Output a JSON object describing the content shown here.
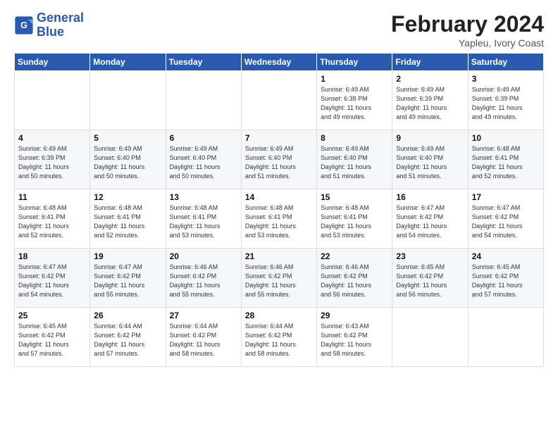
{
  "logo": {
    "line1": "General",
    "line2": "Blue"
  },
  "title": "February 2024",
  "subtitle": "Yapleu, Ivory Coast",
  "days_header": [
    "Sunday",
    "Monday",
    "Tuesday",
    "Wednesday",
    "Thursday",
    "Friday",
    "Saturday"
  ],
  "weeks": [
    [
      {
        "day": "",
        "info": ""
      },
      {
        "day": "",
        "info": ""
      },
      {
        "day": "",
        "info": ""
      },
      {
        "day": "",
        "info": ""
      },
      {
        "day": "1",
        "info": "Sunrise: 6:49 AM\nSunset: 6:38 PM\nDaylight: 11 hours\nand 49 minutes."
      },
      {
        "day": "2",
        "info": "Sunrise: 6:49 AM\nSunset: 6:39 PM\nDaylight: 11 hours\nand 49 minutes."
      },
      {
        "day": "3",
        "info": "Sunrise: 6:49 AM\nSunset: 6:39 PM\nDaylight: 11 hours\nand 49 minutes."
      }
    ],
    [
      {
        "day": "4",
        "info": "Sunrise: 6:49 AM\nSunset: 6:39 PM\nDaylight: 11 hours\nand 50 minutes."
      },
      {
        "day": "5",
        "info": "Sunrise: 6:49 AM\nSunset: 6:40 PM\nDaylight: 11 hours\nand 50 minutes."
      },
      {
        "day": "6",
        "info": "Sunrise: 6:49 AM\nSunset: 6:40 PM\nDaylight: 11 hours\nand 50 minutes."
      },
      {
        "day": "7",
        "info": "Sunrise: 6:49 AM\nSunset: 6:40 PM\nDaylight: 11 hours\nand 51 minutes."
      },
      {
        "day": "8",
        "info": "Sunrise: 6:49 AM\nSunset: 6:40 PM\nDaylight: 11 hours\nand 51 minutes."
      },
      {
        "day": "9",
        "info": "Sunrise: 6:49 AM\nSunset: 6:40 PM\nDaylight: 11 hours\nand 51 minutes."
      },
      {
        "day": "10",
        "info": "Sunrise: 6:48 AM\nSunset: 6:41 PM\nDaylight: 11 hours\nand 52 minutes."
      }
    ],
    [
      {
        "day": "11",
        "info": "Sunrise: 6:48 AM\nSunset: 6:41 PM\nDaylight: 11 hours\nand 52 minutes."
      },
      {
        "day": "12",
        "info": "Sunrise: 6:48 AM\nSunset: 6:41 PM\nDaylight: 11 hours\nand 52 minutes."
      },
      {
        "day": "13",
        "info": "Sunrise: 6:48 AM\nSunset: 6:41 PM\nDaylight: 11 hours\nand 53 minutes."
      },
      {
        "day": "14",
        "info": "Sunrise: 6:48 AM\nSunset: 6:41 PM\nDaylight: 11 hours\nand 53 minutes."
      },
      {
        "day": "15",
        "info": "Sunrise: 6:48 AM\nSunset: 6:41 PM\nDaylight: 11 hours\nand 53 minutes."
      },
      {
        "day": "16",
        "info": "Sunrise: 6:47 AM\nSunset: 6:42 PM\nDaylight: 11 hours\nand 54 minutes."
      },
      {
        "day": "17",
        "info": "Sunrise: 6:47 AM\nSunset: 6:42 PM\nDaylight: 11 hours\nand 54 minutes."
      }
    ],
    [
      {
        "day": "18",
        "info": "Sunrise: 6:47 AM\nSunset: 6:42 PM\nDaylight: 11 hours\nand 54 minutes."
      },
      {
        "day": "19",
        "info": "Sunrise: 6:47 AM\nSunset: 6:42 PM\nDaylight: 11 hours\nand 55 minutes."
      },
      {
        "day": "20",
        "info": "Sunrise: 6:46 AM\nSunset: 6:42 PM\nDaylight: 11 hours\nand 55 minutes."
      },
      {
        "day": "21",
        "info": "Sunrise: 6:46 AM\nSunset: 6:42 PM\nDaylight: 11 hours\nand 55 minutes."
      },
      {
        "day": "22",
        "info": "Sunrise: 6:46 AM\nSunset: 6:42 PM\nDaylight: 11 hours\nand 56 minutes."
      },
      {
        "day": "23",
        "info": "Sunrise: 6:45 AM\nSunset: 6:42 PM\nDaylight: 11 hours\nand 56 minutes."
      },
      {
        "day": "24",
        "info": "Sunrise: 6:45 AM\nSunset: 6:42 PM\nDaylight: 11 hours\nand 57 minutes."
      }
    ],
    [
      {
        "day": "25",
        "info": "Sunrise: 6:45 AM\nSunset: 6:42 PM\nDaylight: 11 hours\nand 57 minutes."
      },
      {
        "day": "26",
        "info": "Sunrise: 6:44 AM\nSunset: 6:42 PM\nDaylight: 11 hours\nand 57 minutes."
      },
      {
        "day": "27",
        "info": "Sunrise: 6:44 AM\nSunset: 6:42 PM\nDaylight: 11 hours\nand 58 minutes."
      },
      {
        "day": "28",
        "info": "Sunrise: 6:44 AM\nSunset: 6:42 PM\nDaylight: 11 hours\nand 58 minutes."
      },
      {
        "day": "29",
        "info": "Sunrise: 6:43 AM\nSunset: 6:42 PM\nDaylight: 11 hours\nand 58 minutes."
      },
      {
        "day": "",
        "info": ""
      },
      {
        "day": "",
        "info": ""
      }
    ]
  ]
}
